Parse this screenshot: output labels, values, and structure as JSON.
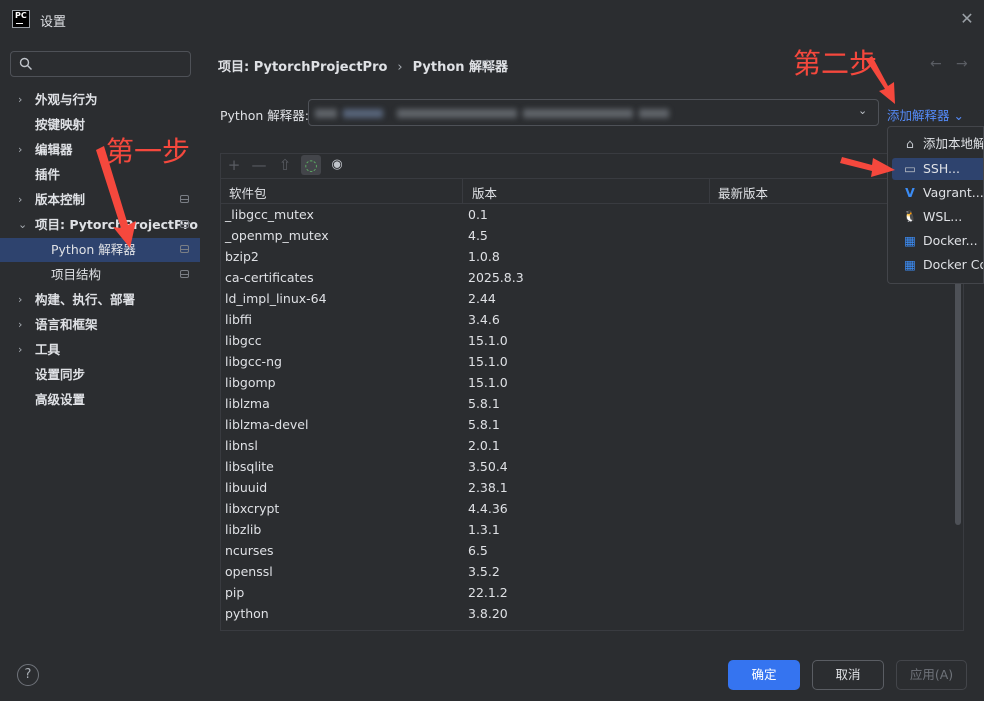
{
  "window": {
    "title": "设置",
    "logo_text": "PC"
  },
  "sidebar": {
    "search_placeholder": "",
    "items": [
      {
        "label": "外观与行为",
        "chevron": "›"
      },
      {
        "label": "按键映射"
      },
      {
        "label": "编辑器",
        "chevron": "›"
      },
      {
        "label": "插件"
      },
      {
        "label": "版本控制",
        "chevron": "›"
      },
      {
        "label": "项目: PytorchProjectPro",
        "chevron": "⌄"
      },
      {
        "label": "Python 解释器"
      },
      {
        "label": "项目结构"
      },
      {
        "label": "构建、执行、部署",
        "chevron": "›"
      },
      {
        "label": "语言和框架",
        "chevron": "›"
      },
      {
        "label": "工具",
        "chevron": "›"
      },
      {
        "label": "设置同步"
      },
      {
        "label": "高级设置"
      }
    ]
  },
  "header": {
    "breadcrumb_project": "项目: PytorchProjectPro",
    "breadcrumb_sep": "›",
    "breadcrumb_page": "Python 解释器",
    "back": "←",
    "forward": "→"
  },
  "interpreter": {
    "label": "Python 解释器:",
    "add_label": "添加解释器 ⌄"
  },
  "annotations": {
    "step1": "第一步",
    "step2": "第二步"
  },
  "toolbar": {
    "add": "+",
    "remove": "—",
    "upgrade": "⇧",
    "refresh": "◌",
    "show": "◉"
  },
  "table": {
    "headers": [
      "软件包",
      "版本",
      "最新版本"
    ],
    "rows": [
      [
        "_libgcc_mutex",
        "0.1"
      ],
      [
        "_openmp_mutex",
        "4.5"
      ],
      [
        "bzip2",
        "1.0.8"
      ],
      [
        "ca-certificates",
        "2025.8.3"
      ],
      [
        "ld_impl_linux-64",
        "2.44"
      ],
      [
        "libffi",
        "3.4.6"
      ],
      [
        "libgcc",
        "15.1.0"
      ],
      [
        "libgcc-ng",
        "15.1.0"
      ],
      [
        "libgomp",
        "15.1.0"
      ],
      [
        "liblzma",
        "5.8.1"
      ],
      [
        "liblzma-devel",
        "5.8.1"
      ],
      [
        "libnsl",
        "2.0.1"
      ],
      [
        "libsqlite",
        "3.50.4"
      ],
      [
        "libuuid",
        "2.38.1"
      ],
      [
        "libxcrypt",
        "4.4.36"
      ],
      [
        "libzlib",
        "1.3.1"
      ],
      [
        "ncurses",
        "6.5"
      ],
      [
        "openssl",
        "3.5.2"
      ],
      [
        "pip",
        "22.1.2"
      ],
      [
        "python",
        "3.8.20"
      ]
    ]
  },
  "popup": {
    "items": [
      {
        "icon": "home-icon",
        "glyph": "⌂",
        "label": "添加本地解释器"
      },
      {
        "icon": "terminal-icon",
        "glyph": "▭",
        "label": "SSH..."
      },
      {
        "icon": "vagrant-icon",
        "glyph": "V",
        "label": "Vagrant..."
      },
      {
        "icon": "linux-icon",
        "glyph": "🐧",
        "label": "WSL..."
      },
      {
        "icon": "docker-icon",
        "glyph": "▦",
        "label": "Docker..."
      },
      {
        "icon": "docker-compose-icon",
        "glyph": "▦",
        "label": "Docker Compose..."
      }
    ]
  },
  "footer": {
    "help": "?",
    "ok": "确定",
    "cancel": "取消",
    "apply": "应用(A)"
  },
  "colors": {
    "accent": "#3574f0",
    "link": "#548af7",
    "selection": "#2e436e",
    "annotation": "#f5483d",
    "background": "#2b2d30"
  }
}
